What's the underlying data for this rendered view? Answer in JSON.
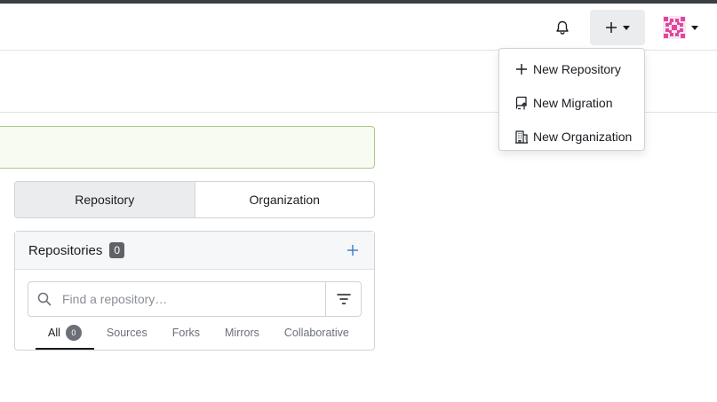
{
  "navbar": {
    "notifications_icon": "bell-icon",
    "create_icon": "plus-icon",
    "avatar_icon": "avatar-identicon"
  },
  "create_menu": {
    "items": [
      {
        "label": "New Repository",
        "icon": "plus-icon"
      },
      {
        "label": "New Migration",
        "icon": "repo-push-icon"
      },
      {
        "label": "New Organization",
        "icon": "organization-icon"
      }
    ]
  },
  "dashboard": {
    "tabs": [
      {
        "label": "Repository",
        "active": true
      },
      {
        "label": "Organization",
        "active": false
      }
    ],
    "repos": {
      "title": "Repositories",
      "count": "0",
      "search_placeholder": "Find a repository…",
      "filters": [
        {
          "label": "All",
          "count": "0",
          "active": true
        },
        {
          "label": "Sources"
        },
        {
          "label": "Forks"
        },
        {
          "label": "Mirrors"
        },
        {
          "label": "Collaborative"
        }
      ]
    }
  },
  "colors": {
    "accent": "#4183c4",
    "badge": "#5f6368",
    "flash_border": "#aec98a",
    "avatar": "#e0479e"
  }
}
